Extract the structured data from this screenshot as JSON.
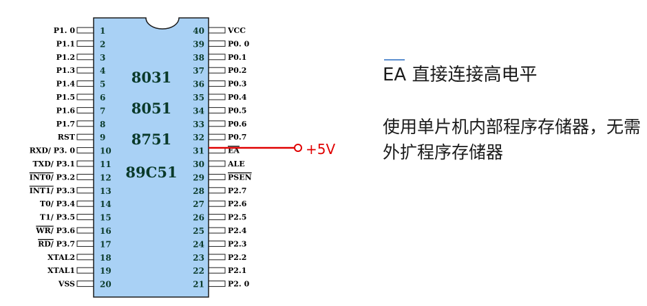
{
  "chip": {
    "names": [
      "8031",
      "8051",
      "8751",
      "89C51"
    ],
    "left_pins": [
      {
        "num": "1",
        "label": "P1. 0",
        "overline": false
      },
      {
        "num": "2",
        "label": "P1.1",
        "overline": false
      },
      {
        "num": "3",
        "label": "P1.2",
        "overline": false
      },
      {
        "num": "4",
        "label": "P1.3",
        "overline": false
      },
      {
        "num": "5",
        "label": "P1.4",
        "overline": false
      },
      {
        "num": "6",
        "label": "P1.5",
        "overline": false
      },
      {
        "num": "7",
        "label": "P1.6",
        "overline": false
      },
      {
        "num": "8",
        "label": "P1.7",
        "overline": false
      },
      {
        "num": "9",
        "label": "RST",
        "overline": false
      },
      {
        "num": "10",
        "label": "RXD/ P3. 0",
        "overline": false
      },
      {
        "num": "11",
        "label": "TXD/ P3.1",
        "overline": false
      },
      {
        "num": "12",
        "label": "INT0/ P3.2",
        "overline": true
      },
      {
        "num": "13",
        "label": "INT1/ P3.3",
        "overline": true
      },
      {
        "num": "14",
        "label": "T0/ P3.4",
        "overline": false
      },
      {
        "num": "15",
        "label": "T1/ P3.5",
        "overline": false
      },
      {
        "num": "16",
        "label": "WR/ P3.6",
        "overline": true
      },
      {
        "num": "17",
        "label": "RD/ P3.7",
        "overline": true
      },
      {
        "num": "18",
        "label": "XTAL2",
        "overline": false
      },
      {
        "num": "19",
        "label": "XTAL1",
        "overline": false
      },
      {
        "num": "20",
        "label": "VSS",
        "overline": false
      }
    ],
    "right_pins": [
      {
        "num": "40",
        "label": "VCC",
        "overline": false
      },
      {
        "num": "39",
        "label": "P0. 0",
        "overline": false
      },
      {
        "num": "38",
        "label": "P0.1",
        "overline": false
      },
      {
        "num": "37",
        "label": "P0.2",
        "overline": false
      },
      {
        "num": "36",
        "label": "P0.3",
        "overline": false
      },
      {
        "num": "35",
        "label": "P0.4",
        "overline": false
      },
      {
        "num": "34",
        "label": "P0.5",
        "overline": false
      },
      {
        "num": "33",
        "label": "P0.6",
        "overline": false
      },
      {
        "num": "32",
        "label": "P0.7",
        "overline": false
      },
      {
        "num": "31",
        "label": "EA",
        "overline": true
      },
      {
        "num": "30",
        "label": "ALE",
        "overline": false
      },
      {
        "num": "29",
        "label": "PSEN",
        "overline": true
      },
      {
        "num": "28",
        "label": "P2.7",
        "overline": false
      },
      {
        "num": "27",
        "label": "P2.6",
        "overline": false
      },
      {
        "num": "26",
        "label": "P2.5",
        "overline": false
      },
      {
        "num": "25",
        "label": "P2.4",
        "overline": false
      },
      {
        "num": "24",
        "label": "P2.3",
        "overline": false
      },
      {
        "num": "23",
        "label": "P2.2",
        "overline": false
      },
      {
        "num": "22",
        "label": "P2.1",
        "overline": false
      },
      {
        "num": "21",
        "label": "P2. 0",
        "overline": false
      }
    ]
  },
  "ea_connection": {
    "label": "+5V",
    "color": "#e00000"
  },
  "notes": {
    "line1_ea": "EA",
    "line1_rest": " 直接连接高电平",
    "line2": "使用单片机内部程序存储器，无需外扩程序存储器"
  },
  "colors": {
    "chip_fill": "#a9d1f5",
    "chip_stroke": "#1a1a1a"
  }
}
